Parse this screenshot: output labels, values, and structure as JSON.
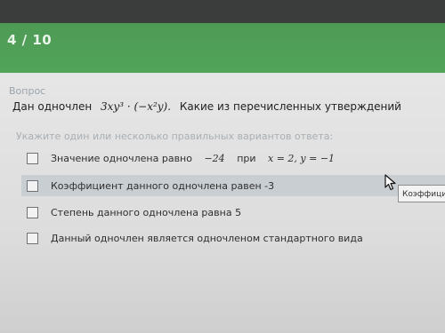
{
  "header": {
    "progress": "4 / 10"
  },
  "question": {
    "label": "Вопрос",
    "prefix": "Дан одночлен",
    "monomial": "3xy³ · (−x²y).",
    "suffix": "Какие из перечисленных утверждений",
    "hint": "Укажите один или несколько правильных вариантов ответа:"
  },
  "options": [
    {
      "prefix": "Значение одночлена равно",
      "math1": "−24",
      "middle": "при",
      "math2": "x = 2, y = −1"
    },
    {
      "text": "Коэффициент данного одночлена равен -3"
    },
    {
      "text": "Степень данного одночлена равна 5"
    },
    {
      "text": "Данный одночлен является одночленом стандартного вида"
    }
  ],
  "tooltip": "Коэффици",
  "colors": {
    "header_green": "#52a45a",
    "header_dark": "#3a3d3c",
    "highlight_row": "#c9ced2"
  }
}
